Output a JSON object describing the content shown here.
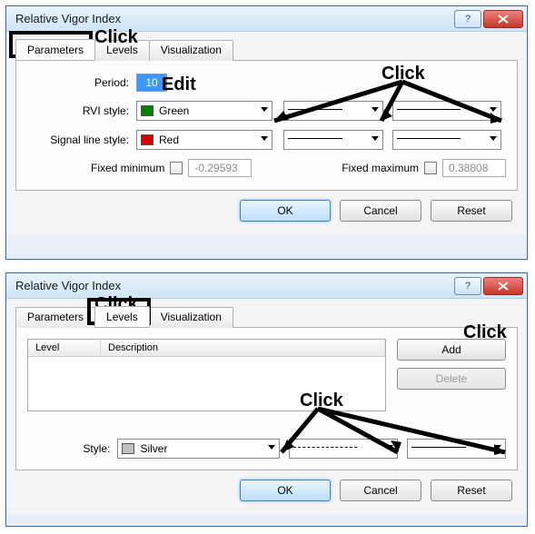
{
  "dialog1": {
    "title": "Relative Vigor Index",
    "tabs": {
      "parameters": "Parameters",
      "levels": "Levels",
      "visualization": "Visualization"
    },
    "period_label": "Period:",
    "period_value": "10",
    "rvi_label": "RVI style:",
    "rvi_color_name": "Green",
    "rvi_color_hex": "#008000",
    "signal_label": "Signal line style:",
    "signal_color_name": "Red",
    "signal_color_hex": "#d00000",
    "fixed_min_label": "Fixed minimum",
    "fixed_min_value": "-0.29593",
    "fixed_max_label": "Fixed maximum",
    "fixed_max_value": "0.38808",
    "ok": "OK",
    "cancel": "Cancel",
    "reset": "Reset"
  },
  "dialog2": {
    "title": "Relative Vigor Index",
    "tabs": {
      "parameters": "Parameters",
      "levels": "Levels",
      "visualization": "Visualization"
    },
    "col_level": "Level",
    "col_description": "Description",
    "add": "Add",
    "delete": "Delete",
    "style_label": "Style:",
    "style_color_name": "Silver",
    "style_color_hex": "#c0c0c0",
    "ok": "OK",
    "cancel": "Cancel",
    "reset": "Reset"
  },
  "annotations": {
    "click": "Click",
    "edit": "Edit"
  }
}
